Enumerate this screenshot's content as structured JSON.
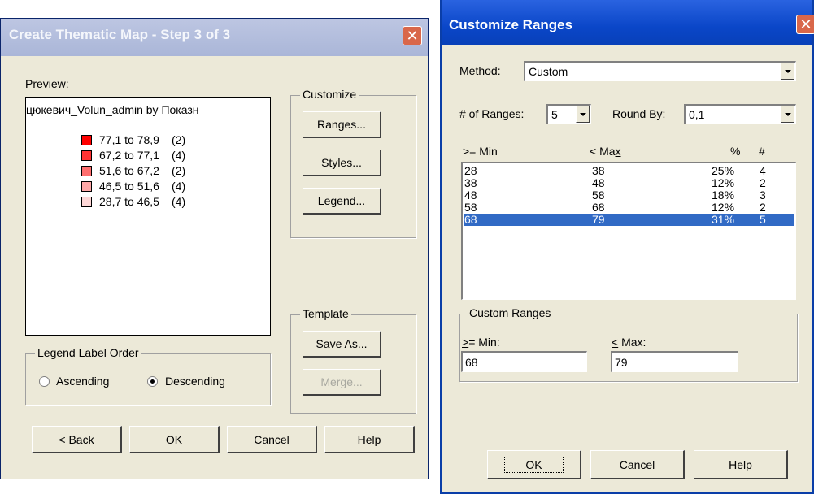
{
  "colors": {
    "accent": "#316ac5",
    "title_blue": "#0a3ea8",
    "close_red": "#d9674a"
  },
  "left_dialog": {
    "title": "Create Thematic Map - Step 3 of 3",
    "close_glyph": "✕",
    "preview_label": "Preview:",
    "legend_title": "цюкевич_Volun_admin by Показн",
    "legend_items": [
      {
        "label": "77,1 to 78,9",
        "count": "(2)",
        "color": "#ff0000"
      },
      {
        "label": "67,2 to 77,1",
        "count": "(4)",
        "color": "#ff3333"
      },
      {
        "label": "51,6 to 67,2",
        "count": "(2)",
        "color": "#ff6f6f"
      },
      {
        "label": "46,5 to 51,6",
        "count": "(4)",
        "color": "#ffa8a8"
      },
      {
        "label": "28,7 to 46,5",
        "count": "(4)",
        "color": "#ffd8d8"
      }
    ],
    "customize": {
      "label": "Customize",
      "ranges": "Ranges...",
      "styles": "Styles...",
      "legend": "Legend..."
    },
    "template": {
      "label": "Template",
      "save_as": "Save As...",
      "merge": "Merge..."
    },
    "order": {
      "label": "Legend Label Order",
      "ascending": "Ascending",
      "descending": "Descending",
      "selected": "Descending"
    },
    "buttons": {
      "back": "< Back",
      "ok": "OK",
      "cancel": "Cancel",
      "help": "Help"
    }
  },
  "right_dialog": {
    "title": "Customize Ranges",
    "close_glyph": "✕",
    "method_label": "Method:",
    "method_value": "Custom",
    "num_ranges_label": "# of Ranges:",
    "num_ranges_value": "5",
    "round_by_label": "Round By:",
    "round_by_value": "0,1",
    "columns": {
      "min": ">= Min",
      "max": "< Max",
      "pct": "%",
      "count": "#"
    },
    "rows": [
      {
        "min": "28",
        "max": "38",
        "pct": "25%",
        "count": "4"
      },
      {
        "min": "38",
        "max": "48",
        "pct": "12%",
        "count": "2"
      },
      {
        "min": "48",
        "max": "58",
        "pct": "18%",
        "count": "3"
      },
      {
        "min": "58",
        "max": "68",
        "pct": "12%",
        "count": "2"
      },
      {
        "min": "68",
        "max": "79",
        "pct": "31%",
        "count": "5"
      }
    ],
    "selected_row_index": 4,
    "custom_ranges": {
      "label": "Custom Ranges",
      "min_label": ">= Min:",
      "max_label": "< Max:",
      "min_value": "68",
      "max_value": "79"
    },
    "buttons": {
      "ok": "OK",
      "cancel": "Cancel",
      "help": "Help"
    }
  }
}
